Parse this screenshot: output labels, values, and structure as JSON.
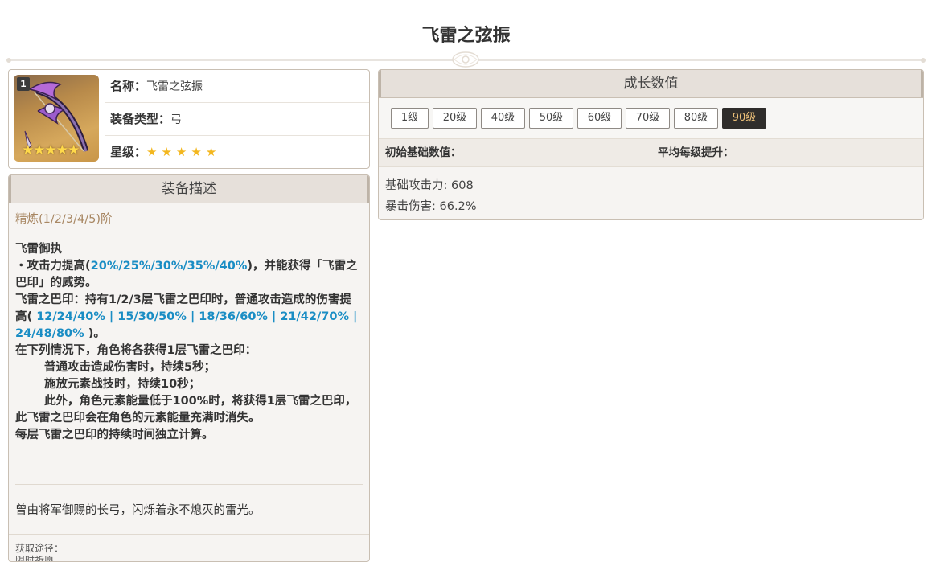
{
  "page": {
    "title": "飞雷之弦振"
  },
  "info": {
    "rarity_badge": "1",
    "name_label": "名称：",
    "name_value": "飞雷之弦振",
    "type_label": "装备类型：",
    "type_value": "弓",
    "stars_label": "星级：",
    "stars": 5
  },
  "description": {
    "header": "装备描述",
    "refine": "精炼(1/2/3/4/5)阶",
    "passive_name": "飞雷御执",
    "line1_a": "・攻击力提高(",
    "line1_vals": "20%/25%/30%/35%/40%",
    "line1_b": ")，并能获得「飞雷之巴印」的威势。",
    "line2_a": "飞雷之巴印：持有1/2/3层飞雷之巴印时，普通攻击造成的伤害提高(",
    "line2_vals": " 12/24/40% | 15/30/50% | 18/36/60% | 21/42/70% | 24/48/80% ",
    "line2_b": ")。",
    "line3": "在下列情况下，角色将各获得1层飞雷之巴印：",
    "line4": "普通攻击造成伤害时，持续5秒；",
    "line5": "施放元素战技时，持续10秒；",
    "line6": "此外，角色元素能量低于100%时，将获得1层飞雷之巴印，此飞雷之巴印会在角色的元素能量充满时消失。",
    "line7": "每层飞雷之巴印的持续时间独立计算。",
    "lore": "曾由将军御赐的长弓，闪烁着永不熄灭的雷光。",
    "source_label": "获取途径：",
    "source_value": "限时祈愿"
  },
  "stats": {
    "header": "成长数值",
    "levels": [
      "1级",
      "20级",
      "40级",
      "50级",
      "60级",
      "70级",
      "80级",
      "90级"
    ],
    "active_level": "90级",
    "col_base": "初始基础数值：",
    "col_growth": "平均每级提升：",
    "atk": "基础攻击力: 608",
    "crit": "暴击伤害: 66.2%"
  }
}
